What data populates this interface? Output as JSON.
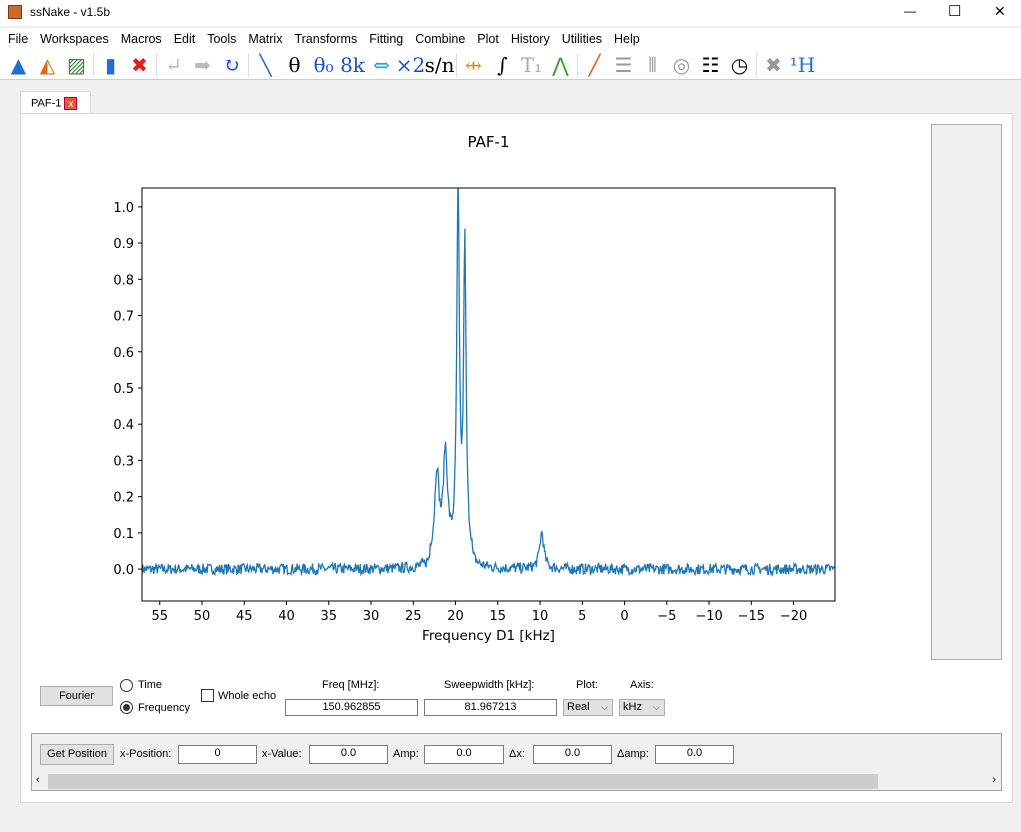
{
  "window": {
    "title": "ssNake - v1.5b",
    "minimize": "—",
    "maximize": "☐",
    "close": "✕"
  },
  "menu": [
    "File",
    "Workspaces",
    "Macros",
    "Edit",
    "Tools",
    "Matrix",
    "Transforms",
    "Fitting",
    "Combine",
    "Plot",
    "History",
    "Utilities",
    "Help"
  ],
  "toolbar": [
    {
      "name": "open-icon",
      "glyph": "▲",
      "color": "#1e6fd0"
    },
    {
      "name": "matlab-icon",
      "glyph": "◭",
      "color": "#e06a1a"
    },
    {
      "name": "image-icon",
      "glyph": "▨",
      "color": "#3a8a3a"
    },
    {
      "name": "duplicate-icon",
      "glyph": "▮",
      "color": "#1e6fd0"
    },
    {
      "name": "delete-icon",
      "glyph": "✖",
      "color": "#e02020"
    },
    {
      "name": "undo-icon",
      "glyph": "↵",
      "color": "#bbbbbb"
    },
    {
      "name": "redo-icon",
      "glyph": "➡",
      "color": "#bbbbbb"
    },
    {
      "name": "reload-icon",
      "glyph": "↻",
      "color": "#1e4fd0"
    },
    {
      "name": "phase-icon",
      "glyph": "╲",
      "color": "#1e6fd0"
    },
    {
      "name": "theta-icon",
      "glyph": "θ",
      "color": "#000"
    },
    {
      "name": "theta0-icon",
      "glyph": "θ₀",
      "color": "#1e4fd0"
    },
    {
      "name": "8k-icon",
      "glyph": "8k",
      "color": "#1e4fd0"
    },
    {
      "name": "swap-icon",
      "glyph": "⇔",
      "color": "#1e9fe0"
    },
    {
      "name": "multiply2-icon",
      "glyph": "×2",
      "color": "#1e4fd0"
    },
    {
      "name": "snr-icon",
      "glyph": "s/n",
      "color": "#000"
    },
    {
      "name": "width-icon",
      "glyph": "⇹",
      "color": "#e08a1a"
    },
    {
      "name": "integral-icon",
      "glyph": "∫",
      "color": "#000"
    },
    {
      "name": "t1-icon",
      "glyph": "T₁",
      "color": "#aaaaaa"
    },
    {
      "name": "peak-icon",
      "glyph": "⋀",
      "color": "#2aa02a"
    },
    {
      "name": "line-icon",
      "glyph": "╱",
      "color": "#f05a1a"
    },
    {
      "name": "stack-icon",
      "glyph": "☰",
      "color": "#999"
    },
    {
      "name": "array-icon",
      "glyph": "⦀",
      "color": "#999"
    },
    {
      "name": "contour-icon",
      "glyph": "◎",
      "color": "#999"
    },
    {
      "name": "list-icon",
      "glyph": "☷",
      "color": "#000"
    },
    {
      "name": "clock-icon",
      "glyph": "◷",
      "color": "#000"
    },
    {
      "name": "close-gray-icon",
      "glyph": "✖",
      "color": "#999"
    },
    {
      "name": "1h-icon",
      "glyph": "¹H",
      "color": "#1e6fd0"
    }
  ],
  "tab": {
    "label": "PAF-1",
    "close": "x"
  },
  "chart_data": {
    "type": "line",
    "title": "PAF-1",
    "xlabel": "Frequency D1 [kHz]",
    "ylabel": "",
    "xlim": [
      57.1,
      -24.9
    ],
    "ylim": [
      -0.088,
      1.052
    ],
    "xticks": [
      55,
      50,
      45,
      40,
      35,
      30,
      25,
      20,
      15,
      10,
      5,
      0,
      -5,
      -10,
      -15,
      -20
    ],
    "xtick_labels": [
      "55",
      "50",
      "45",
      "40",
      "35",
      "30",
      "25",
      "20",
      "15",
      "10",
      "5",
      "0",
      "−5",
      "−10",
      "−15",
      "−20"
    ],
    "yticks": [
      0.0,
      0.1,
      0.2,
      0.3,
      0.4,
      0.5,
      0.6,
      0.7,
      0.8,
      0.9,
      1.0
    ],
    "ytick_labels": [
      "0.0",
      "0.1",
      "0.2",
      "0.3",
      "0.4",
      "0.5",
      "0.6",
      "0.7",
      "0.8",
      "0.9",
      "1.0"
    ],
    "color": "#1f77b4",
    "grid": false,
    "peaks": [
      {
        "x": 22.2,
        "y": 0.23
      },
      {
        "x": 21.2,
        "y": 0.28
      },
      {
        "x": 19.7,
        "y": 1.0
      },
      {
        "x": 18.9,
        "y": 0.85
      },
      {
        "x": 9.8,
        "y": 0.1
      }
    ],
    "baseline_noise": 0.015
  },
  "controls": {
    "fourier": "Fourier",
    "time": "Time",
    "frequency": "Frequency",
    "whole_echo": "Whole echo",
    "freq_label": "Freq [MHz]:",
    "freq_value": "150.962855",
    "sw_label": "Sweepwidth [kHz]:",
    "sw_value": "81.967213",
    "plot_label": "Plot:",
    "plot_value": "Real",
    "axis_label": "Axis:",
    "axis_value": "kHz",
    "domain": "frequency"
  },
  "position": {
    "get": "Get Position",
    "xpos_label": "x-Position:",
    "xpos": "0",
    "xval_label": "x-Value:",
    "xval": "0.0",
    "amp_label": "Amp:",
    "amp": "0.0",
    "dx_label": "Δx:",
    "dx": "0.0",
    "damp_label": "Δamp:",
    "damp": "0.0"
  }
}
